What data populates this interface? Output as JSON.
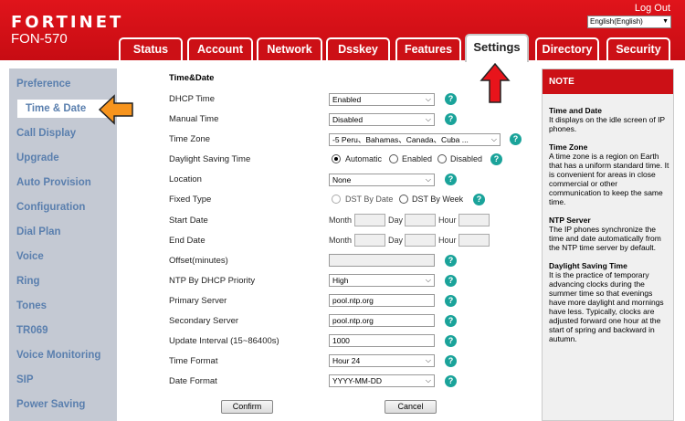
{
  "header": {
    "logo": "FORTINET",
    "model": "FON-570",
    "logout": "Log Out",
    "language": "English(English)"
  },
  "tabs": [
    {
      "label": "Status"
    },
    {
      "label": "Account"
    },
    {
      "label": "Network"
    },
    {
      "label": "Dsskey"
    },
    {
      "label": "Features"
    },
    {
      "label": "Settings",
      "active": true
    },
    {
      "label": "Directory"
    },
    {
      "label": "Security"
    }
  ],
  "sidebar": {
    "items": [
      {
        "label": "Preference"
      },
      {
        "label": "Time & Date",
        "active": true
      },
      {
        "label": "Call Display"
      },
      {
        "label": "Upgrade"
      },
      {
        "label": "Auto Provision"
      },
      {
        "label": "Configuration"
      },
      {
        "label": "Dial Plan"
      },
      {
        "label": "Voice"
      },
      {
        "label": "Ring"
      },
      {
        "label": "Tones"
      },
      {
        "label": "TR069"
      },
      {
        "label": "Voice Monitoring"
      },
      {
        "label": "SIP"
      },
      {
        "label": "Power Saving"
      }
    ]
  },
  "form": {
    "title": "Time&Date",
    "dhcp_time": {
      "label": "DHCP Time",
      "value": "Enabled"
    },
    "manual_time": {
      "label": "Manual Time",
      "value": "Disabled"
    },
    "time_zone": {
      "label": "Time Zone",
      "value": "-5 Peru、Bahamas、Canada、Cuba ..."
    },
    "dst": {
      "label": "Daylight Saving Time",
      "options": [
        "Automatic",
        "Enabled",
        "Disabled"
      ],
      "selected": "Automatic"
    },
    "location": {
      "label": "Location",
      "value": "None"
    },
    "fixed_type": {
      "label": "Fixed Type",
      "options": [
        "DST By Date",
        "DST By Week"
      ]
    },
    "start_date": {
      "label": "Start Date"
    },
    "end_date": {
      "label": "End Date"
    },
    "date_parts": {
      "month": "Month",
      "day": "Day",
      "hour": "Hour"
    },
    "offset": {
      "label": "Offset(minutes)",
      "value": ""
    },
    "ntp_priority": {
      "label": "NTP By DHCP Priority",
      "value": "High"
    },
    "primary_server": {
      "label": "Primary Server",
      "value": "pool.ntp.org"
    },
    "secondary_server": {
      "label": "Secondary Server",
      "value": "pool.ntp.org"
    },
    "update_interval": {
      "label": "Update Interval (15~86400s)",
      "value": "1000"
    },
    "time_format": {
      "label": "Time Format",
      "value": "Hour 24"
    },
    "date_format": {
      "label": "Date Format",
      "value": "YYYY-MM-DD"
    },
    "confirm": "Confirm",
    "cancel": "Cancel",
    "help_glyph": "?"
  },
  "note": {
    "title": "NOTE",
    "sections": [
      {
        "title": "Time and Date",
        "text": "It displays on the idle screen of IP phones."
      },
      {
        "title": "Time Zone",
        "text": "A time zone is a region on Earth that has a uniform standard time. It is convenient for areas in close commercial or other communication to keep the same time."
      },
      {
        "title": "NTP Server",
        "text": "The IP phones synchronize the time and date automatically from the NTP time server by default."
      },
      {
        "title": "Daylight Saving Time",
        "text": "It is the practice of temporary advancing clocks during the summer time so that evenings have more daylight and mornings have less. Typically, clocks are adjusted forward one hour at the start of spring and backward in autumn."
      }
    ]
  },
  "colors": {
    "brand_red": "#cc1016",
    "sidebar_bg": "#c4c9d3",
    "sidebar_text": "#5a7fae",
    "help_teal": "#1aa39a",
    "callout_orange": "#f7941d",
    "callout_red": "#e8141b"
  }
}
